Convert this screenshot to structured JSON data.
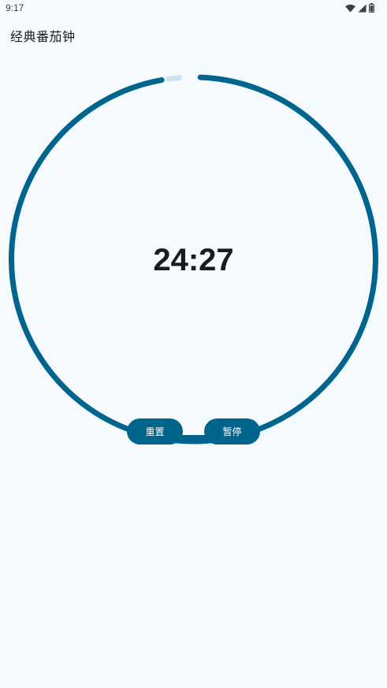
{
  "status_bar": {
    "time": "9:17",
    "icons": [
      "wifi-icon",
      "signal-icon",
      "battery-icon"
    ]
  },
  "app": {
    "title": "经典番茄钟"
  },
  "timer": {
    "display": "24:27",
    "progress_remaining_fraction": 0.978
  },
  "controls": {
    "reset_label": "重置",
    "pause_label": "暂停"
  },
  "colors": {
    "background": "#f4fafd",
    "accent": "#00658c",
    "track": "#cfe4f2",
    "text": "#191c1e"
  }
}
